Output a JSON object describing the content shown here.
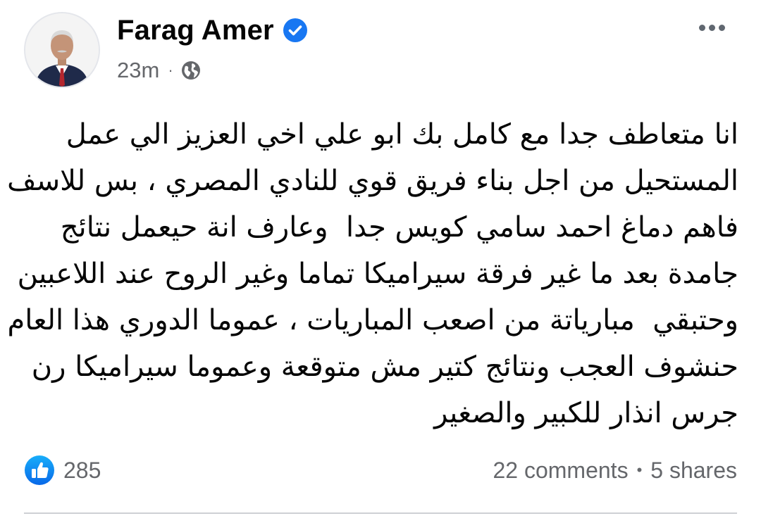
{
  "post": {
    "author": {
      "name": "Farag Amer",
      "verified_icon": "verified-badge-icon",
      "avatar": "profile-photo"
    },
    "meta": {
      "time": "23m",
      "separator": "·",
      "privacy_icon": "globe-icon"
    },
    "more_icon": "more-options-icon",
    "text_lines": [
      "انا متعاطف جدا مع كامل بك ابو علي اخي العزيز الي عمل",
      "المستحيل من اجل بناء فريق قوي للنادي المصري ، بس للاسف انا",
      "فاهم دماغ احمد سامي كويس جدا  وعارف انة حيعمل نتائج",
      "جامدة بعد ما غير فرقة سيراميكا تماما وغير الروح عند اللاعبين",
      "وحتبقي  مبارياتة من اصعب المباريات ، عموما الدوري هذا العام",
      "حنشوف العجب ونتائج كتير مش متوقعة وعموما سيراميكا رن",
      "جرس انذار للكبير والصغير"
    ],
    "footer": {
      "reaction_icon": "like-reaction-icon",
      "reactions_count": "285",
      "comments": "22 comments",
      "separator": "•",
      "shares": "5 shares"
    },
    "colors": {
      "verified_blue": "#1877f2",
      "secondary_text": "#65676b",
      "primary_text": "#050505"
    }
  }
}
